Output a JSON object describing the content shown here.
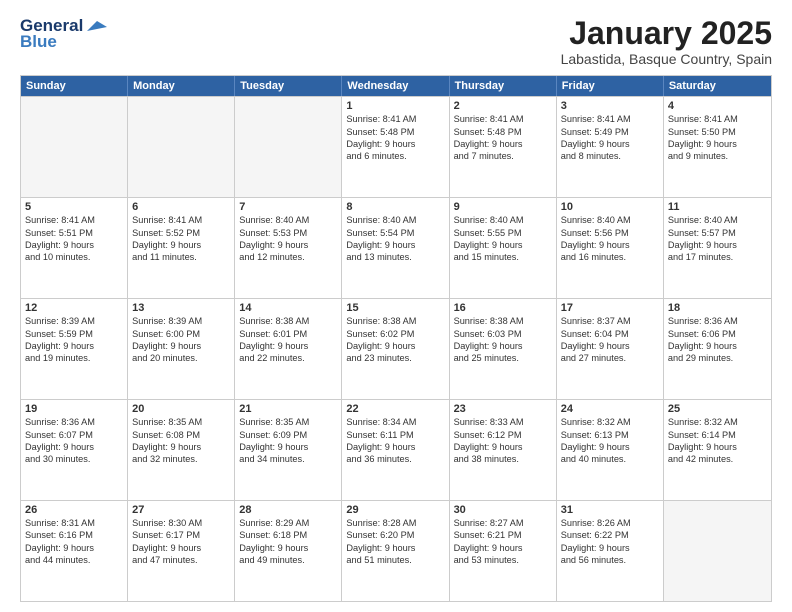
{
  "logo": {
    "line1": "General",
    "line2": "Blue"
  },
  "title": "January 2025",
  "subtitle": "Labastida, Basque Country, Spain",
  "days": [
    "Sunday",
    "Monday",
    "Tuesday",
    "Wednesday",
    "Thursday",
    "Friday",
    "Saturday"
  ],
  "weeks": [
    [
      {
        "day": "",
        "text": ""
      },
      {
        "day": "",
        "text": ""
      },
      {
        "day": "",
        "text": ""
      },
      {
        "day": "1",
        "text": "Sunrise: 8:41 AM\nSunset: 5:48 PM\nDaylight: 9 hours\nand 6 minutes."
      },
      {
        "day": "2",
        "text": "Sunrise: 8:41 AM\nSunset: 5:48 PM\nDaylight: 9 hours\nand 7 minutes."
      },
      {
        "day": "3",
        "text": "Sunrise: 8:41 AM\nSunset: 5:49 PM\nDaylight: 9 hours\nand 8 minutes."
      },
      {
        "day": "4",
        "text": "Sunrise: 8:41 AM\nSunset: 5:50 PM\nDaylight: 9 hours\nand 9 minutes."
      }
    ],
    [
      {
        "day": "5",
        "text": "Sunrise: 8:41 AM\nSunset: 5:51 PM\nDaylight: 9 hours\nand 10 minutes."
      },
      {
        "day": "6",
        "text": "Sunrise: 8:41 AM\nSunset: 5:52 PM\nDaylight: 9 hours\nand 11 minutes."
      },
      {
        "day": "7",
        "text": "Sunrise: 8:40 AM\nSunset: 5:53 PM\nDaylight: 9 hours\nand 12 minutes."
      },
      {
        "day": "8",
        "text": "Sunrise: 8:40 AM\nSunset: 5:54 PM\nDaylight: 9 hours\nand 13 minutes."
      },
      {
        "day": "9",
        "text": "Sunrise: 8:40 AM\nSunset: 5:55 PM\nDaylight: 9 hours\nand 15 minutes."
      },
      {
        "day": "10",
        "text": "Sunrise: 8:40 AM\nSunset: 5:56 PM\nDaylight: 9 hours\nand 16 minutes."
      },
      {
        "day": "11",
        "text": "Sunrise: 8:40 AM\nSunset: 5:57 PM\nDaylight: 9 hours\nand 17 minutes."
      }
    ],
    [
      {
        "day": "12",
        "text": "Sunrise: 8:39 AM\nSunset: 5:59 PM\nDaylight: 9 hours\nand 19 minutes."
      },
      {
        "day": "13",
        "text": "Sunrise: 8:39 AM\nSunset: 6:00 PM\nDaylight: 9 hours\nand 20 minutes."
      },
      {
        "day": "14",
        "text": "Sunrise: 8:38 AM\nSunset: 6:01 PM\nDaylight: 9 hours\nand 22 minutes."
      },
      {
        "day": "15",
        "text": "Sunrise: 8:38 AM\nSunset: 6:02 PM\nDaylight: 9 hours\nand 23 minutes."
      },
      {
        "day": "16",
        "text": "Sunrise: 8:38 AM\nSunset: 6:03 PM\nDaylight: 9 hours\nand 25 minutes."
      },
      {
        "day": "17",
        "text": "Sunrise: 8:37 AM\nSunset: 6:04 PM\nDaylight: 9 hours\nand 27 minutes."
      },
      {
        "day": "18",
        "text": "Sunrise: 8:36 AM\nSunset: 6:06 PM\nDaylight: 9 hours\nand 29 minutes."
      }
    ],
    [
      {
        "day": "19",
        "text": "Sunrise: 8:36 AM\nSunset: 6:07 PM\nDaylight: 9 hours\nand 30 minutes."
      },
      {
        "day": "20",
        "text": "Sunrise: 8:35 AM\nSunset: 6:08 PM\nDaylight: 9 hours\nand 32 minutes."
      },
      {
        "day": "21",
        "text": "Sunrise: 8:35 AM\nSunset: 6:09 PM\nDaylight: 9 hours\nand 34 minutes."
      },
      {
        "day": "22",
        "text": "Sunrise: 8:34 AM\nSunset: 6:11 PM\nDaylight: 9 hours\nand 36 minutes."
      },
      {
        "day": "23",
        "text": "Sunrise: 8:33 AM\nSunset: 6:12 PM\nDaylight: 9 hours\nand 38 minutes."
      },
      {
        "day": "24",
        "text": "Sunrise: 8:32 AM\nSunset: 6:13 PM\nDaylight: 9 hours\nand 40 minutes."
      },
      {
        "day": "25",
        "text": "Sunrise: 8:32 AM\nSunset: 6:14 PM\nDaylight: 9 hours\nand 42 minutes."
      }
    ],
    [
      {
        "day": "26",
        "text": "Sunrise: 8:31 AM\nSunset: 6:16 PM\nDaylight: 9 hours\nand 44 minutes."
      },
      {
        "day": "27",
        "text": "Sunrise: 8:30 AM\nSunset: 6:17 PM\nDaylight: 9 hours\nand 47 minutes."
      },
      {
        "day": "28",
        "text": "Sunrise: 8:29 AM\nSunset: 6:18 PM\nDaylight: 9 hours\nand 49 minutes."
      },
      {
        "day": "29",
        "text": "Sunrise: 8:28 AM\nSunset: 6:20 PM\nDaylight: 9 hours\nand 51 minutes."
      },
      {
        "day": "30",
        "text": "Sunrise: 8:27 AM\nSunset: 6:21 PM\nDaylight: 9 hours\nand 53 minutes."
      },
      {
        "day": "31",
        "text": "Sunrise: 8:26 AM\nSunset: 6:22 PM\nDaylight: 9 hours\nand 56 minutes."
      },
      {
        "day": "",
        "text": ""
      }
    ]
  ]
}
